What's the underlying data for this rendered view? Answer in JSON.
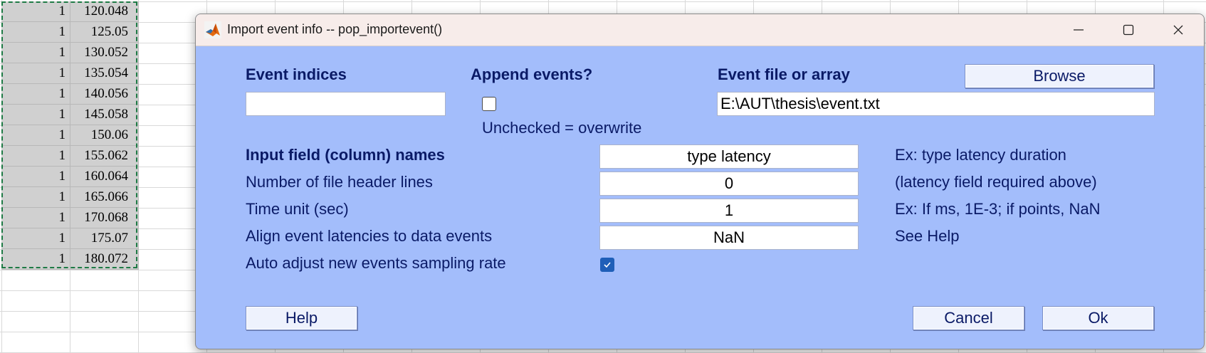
{
  "spreadsheet": {
    "rows": [
      {
        "a": "1",
        "b": "120.048"
      },
      {
        "a": "1",
        "b": "125.05"
      },
      {
        "a": "1",
        "b": "130.052"
      },
      {
        "a": "1",
        "b": "135.054"
      },
      {
        "a": "1",
        "b": "140.056"
      },
      {
        "a": "1",
        "b": "145.058"
      },
      {
        "a": "1",
        "b": "150.06"
      },
      {
        "a": "1",
        "b": "155.062"
      },
      {
        "a": "1",
        "b": "160.064"
      },
      {
        "a": "1",
        "b": "165.066"
      },
      {
        "a": "1",
        "b": "170.068"
      },
      {
        "a": "1",
        "b": "175.07"
      },
      {
        "a": "1",
        "b": "180.072"
      }
    ]
  },
  "dialog": {
    "title": "Import event info -- pop_importevent()",
    "event_indices_label": "Event indices",
    "event_indices_value": "",
    "append_label": "Append events?",
    "append_checked": false,
    "append_hint": "Unchecked = overwrite",
    "event_file_label": "Event file or array",
    "browse_label": "Browse",
    "event_file_value": "E:\\AUT\\thesis\\event.txt",
    "fields_label": "Input field (column) names",
    "fields_value": "type latency",
    "fields_hint": "Ex: type latency duration",
    "header_lines_label": "Number of file header lines",
    "header_lines_value": "0",
    "header_lines_hint": "(latency field required above)",
    "time_unit_label": "Time unit (sec)",
    "time_unit_value": "1",
    "time_unit_hint": "Ex: If ms, 1E-3; if points, NaN",
    "align_label": "Align event latencies to data events",
    "align_value": "NaN",
    "align_hint": "See Help",
    "auto_adjust_label": "Auto adjust new events sampling rate",
    "auto_adjust_checked": true,
    "help_label": "Help",
    "cancel_label": "Cancel",
    "ok_label": "Ok"
  },
  "colors": {
    "dialog_bg": "#a3bdfb",
    "label_text": "#0a1a66",
    "checkbox_checked": "#1f5fb8",
    "selection_border": "#1e7a45"
  }
}
